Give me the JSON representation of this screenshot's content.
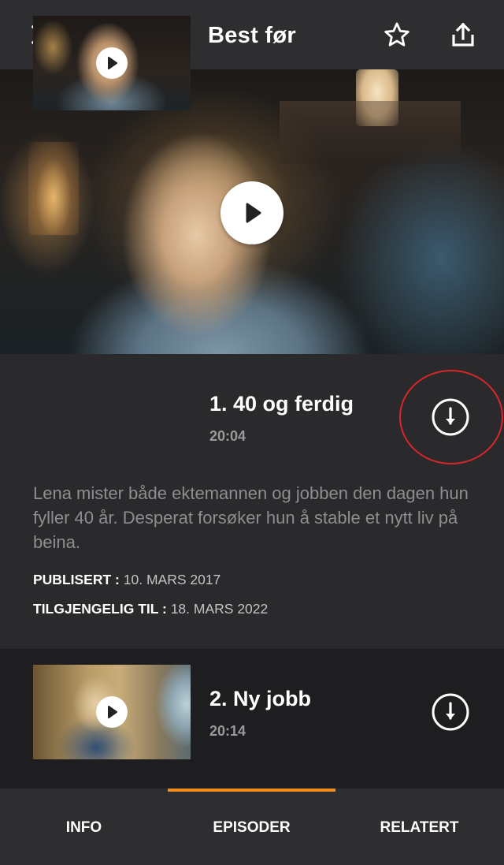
{
  "header": {
    "title": "Best før",
    "close_icon": "close-icon",
    "favorite_icon": "star-outline-icon",
    "share_icon": "share-icon"
  },
  "hero": {
    "play_icon": "play-icon"
  },
  "episodes": [
    {
      "title": "1. 40 og ferdig",
      "duration": "20:04",
      "description": "Lena mister både ektemannen og jobben den dagen hun fyller 40 år. Desperat forsøker hun å stable et nytt liv på beina.",
      "published_label": "PUBLISERT :",
      "published_value": "10. MARS 2017",
      "available_label": "TILGJENGELIG TIL :",
      "available_value": "18. MARS 2022",
      "download_icon": "download-icon"
    },
    {
      "title": "2. Ny jobb",
      "duration": "20:14",
      "download_icon": "download-icon"
    }
  ],
  "tabs": [
    {
      "label": "INFO",
      "active": false
    },
    {
      "label": "EPISODER",
      "active": true
    },
    {
      "label": "RELATERT",
      "active": false
    }
  ],
  "colors": {
    "accent": "#f28c1e",
    "highlight_ring": "#d8262a",
    "header_bg": "#2e2e30",
    "expanded_bg": "#2a2a2c",
    "page_bg": "#1e1e20"
  }
}
